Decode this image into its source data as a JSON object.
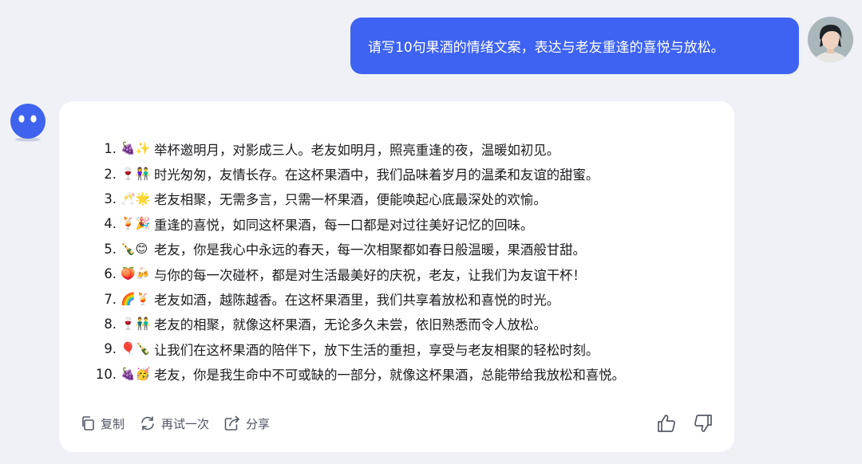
{
  "user_message": {
    "text": "请写10句果酒的情绪文案，表达与老友重逢的喜悦与放松。"
  },
  "answer": {
    "items": [
      {
        "num": "1.",
        "emoji": "🍇✨",
        "text": "举杯邀明月，对影成三人。老友如明月，照亮重逢的夜，温暖如初见。"
      },
      {
        "num": "2.",
        "emoji": "🍷👫",
        "text": "时光匆匆，友情长存。在这杯果酒中，我们品味着岁月的温柔和友谊的甜蜜。"
      },
      {
        "num": "3.",
        "emoji": "🥂🌟",
        "text": "老友相聚，无需多言，只需一杯果酒，便能唤起心底最深处的欢愉。"
      },
      {
        "num": "4.",
        "emoji": "🍹🎉",
        "text": "重逢的喜悦，如同这杯果酒，每一口都是对过往美好记忆的回味。"
      },
      {
        "num": "5.",
        "emoji": "🍾😊",
        "text": "老友，你是我心中永远的春天，每一次相聚都如春日般温暖，果酒般甘甜。"
      },
      {
        "num": "6.",
        "emoji": "🍑🍻",
        "text": "与你的每一次碰杯，都是对生活最美好的庆祝，老友，让我们为友谊干杯！"
      },
      {
        "num": "7.",
        "emoji": "🌈🍹",
        "text": "老友如酒，越陈越香。在这杯果酒里，我们共享着放松和喜悦的时光。"
      },
      {
        "num": "8.",
        "emoji": "🍷👬",
        "text": "老友的相聚，就像这杯果酒，无论多久未尝，依旧熟悉而令人放松。"
      },
      {
        "num": "9.",
        "emoji": "🎈🍾",
        "text": "让我们在这杯果酒的陪伴下，放下生活的重担，享受与老友相聚的轻松时刻。"
      },
      {
        "num": "10.",
        "emoji": "🍇🥳",
        "text": "老友，你是我生命中不可或缺的一部分，就像这杯果酒，总能带给我放松和喜悦。"
      }
    ]
  },
  "actions": {
    "copy": "复制",
    "retry": "再试一次",
    "share": "分享"
  },
  "colors": {
    "accent": "#3e63f2",
    "background": "#eff1f7"
  },
  "icons": [
    "copy-icon",
    "retry-icon",
    "share-icon",
    "thumbs-up-icon",
    "thumbs-down-icon"
  ]
}
